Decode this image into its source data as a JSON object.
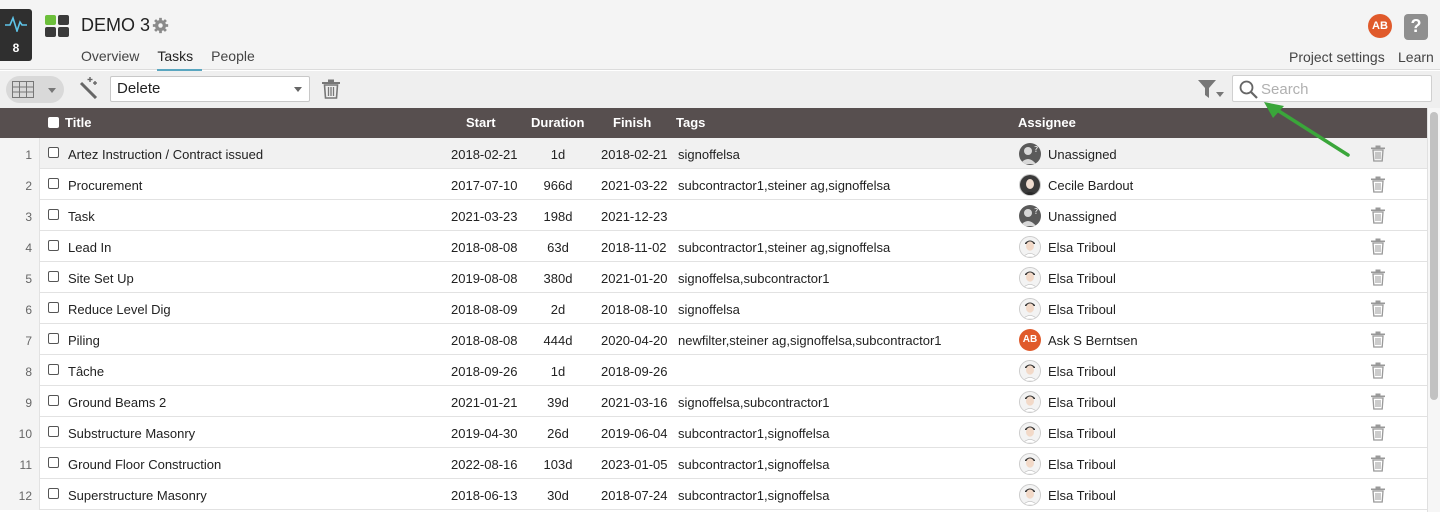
{
  "activity": {
    "count": "8"
  },
  "project": {
    "title": "DEMO 3"
  },
  "tabs": [
    {
      "label": "Overview"
    },
    {
      "label": "Tasks"
    },
    {
      "label": "People"
    }
  ],
  "header_right": {
    "avatar": "AB",
    "help": "?",
    "project_settings": "Project settings",
    "learn": "Learn"
  },
  "toolbar": {
    "action_select": "Delete",
    "search_placeholder": "Search"
  },
  "columns": {
    "title": "Title",
    "start": "Start",
    "duration": "Duration",
    "finish": "Finish",
    "tags": "Tags",
    "assignee": "Assignee"
  },
  "rows": [
    {
      "num": "1",
      "title": "Artez Instruction / Contract issued",
      "start": "2018-02-21",
      "duration": "1d",
      "finish": "2018-02-21",
      "tags": "signoffelsa",
      "assignee": "Unassigned",
      "avatar": "unassigned"
    },
    {
      "num": "2",
      "title": "Procurement",
      "start": "2017-07-10",
      "duration": "966d",
      "finish": "2021-03-22",
      "tags": "subcontractor1,steiner ag,signoffelsa",
      "assignee": "Cecile Bardout",
      "avatar": "photo-female"
    },
    {
      "num": "3",
      "title": "Task",
      "start": "2021-03-23",
      "duration": "198d",
      "finish": "2021-12-23",
      "tags": "",
      "assignee": "Unassigned",
      "avatar": "unassigned"
    },
    {
      "num": "4",
      "title": "Lead In",
      "start": "2018-08-08",
      "duration": "63d",
      "finish": "2018-11-02",
      "tags": "subcontractor1,steiner ag,signoffelsa",
      "assignee": "Elsa Triboul",
      "avatar": "photo-male"
    },
    {
      "num": "5",
      "title": "Site Set Up",
      "start": "2019-08-08",
      "duration": "380d",
      "finish": "2021-01-20",
      "tags": "signoffelsa,subcontractor1",
      "assignee": "Elsa Triboul",
      "avatar": "photo-male"
    },
    {
      "num": "6",
      "title": "Reduce Level Dig",
      "start": "2018-08-09",
      "duration": "2d",
      "finish": "2018-08-10",
      "tags": "signoffelsa",
      "assignee": "Elsa Triboul",
      "avatar": "photo-male"
    },
    {
      "num": "7",
      "title": "Piling",
      "start": "2018-08-08",
      "duration": "444d",
      "finish": "2020-04-20",
      "tags": "newfilter,steiner ag,signoffelsa,subcontractor1",
      "assignee": "Ask S Berntsen",
      "avatar": "AB"
    },
    {
      "num": "8",
      "title": "Tâche",
      "start": "2018-09-26",
      "duration": "1d",
      "finish": "2018-09-26",
      "tags": "",
      "assignee": "Elsa Triboul",
      "avatar": "photo-male"
    },
    {
      "num": "9",
      "title": "Ground Beams 2",
      "start": "2021-01-21",
      "duration": "39d",
      "finish": "2021-03-16",
      "tags": "signoffelsa,subcontractor1",
      "assignee": "Elsa Triboul",
      "avatar": "photo-male"
    },
    {
      "num": "10",
      "title": "Substructure Masonry",
      "start": "2019-04-30",
      "duration": "26d",
      "finish": "2019-06-04",
      "tags": "subcontractor1,signoffelsa",
      "assignee": "Elsa Triboul",
      "avatar": "photo-male"
    },
    {
      "num": "11",
      "title": "Ground Floor Construction",
      "start": "2022-08-16",
      "duration": "103d",
      "finish": "2023-01-05",
      "tags": "subcontractor1,signoffelsa",
      "assignee": "Elsa Triboul",
      "avatar": "photo-male"
    },
    {
      "num": "12",
      "title": "Superstructure Masonry",
      "start": "2018-06-13",
      "duration": "30d",
      "finish": "2018-07-24",
      "tags": "subcontractor1,signoffelsa",
      "assignee": "Elsa Triboul",
      "avatar": "photo-male"
    }
  ],
  "colors": {
    "header_bg": "#f4f4f4",
    "table_header_bg": "#574f4f",
    "accent_tab": "#5aa6c0",
    "avatar_ab": "#e05a2b",
    "arrow_annotation": "#3aa63a",
    "app_icon_green": "#6cbf3b",
    "app_icon_dark": "#3a3a3a"
  },
  "icons": [
    "activity-icon",
    "app-grid-icon",
    "gear-icon",
    "grid-view-icon",
    "magic-wand-icon",
    "trash-icon",
    "filter-icon",
    "search-icon",
    "help-icon"
  ]
}
